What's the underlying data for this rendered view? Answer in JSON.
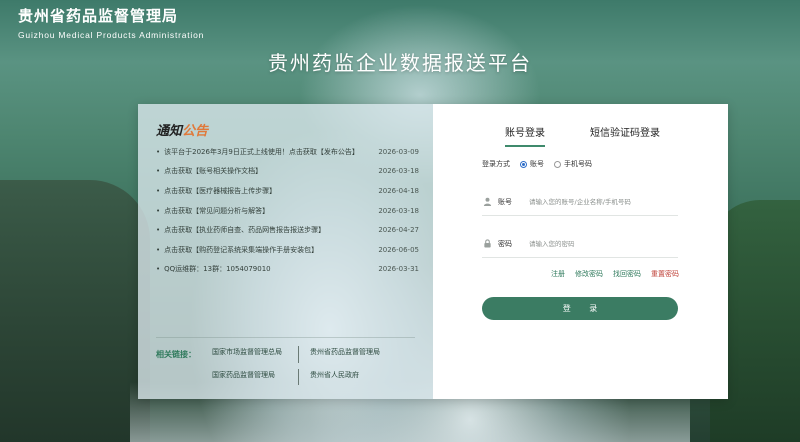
{
  "brand": {
    "name_cn": "贵州省药品监督管理局",
    "name_en": "Guizhou Medical Products Administration"
  },
  "platform_title": "贵州药监企业数据报送平台",
  "notices": {
    "heading_main": "通知",
    "heading_accent": "公告",
    "items": [
      {
        "title": "该平台于2026年3月9日正式上线使用！点击获取【发布公告】",
        "date": "2026-03-09"
      },
      {
        "title": "点击获取【账号相关操作文档】",
        "date": "2026-03-18"
      },
      {
        "title": "点击获取【医疗器械报告上传步骤】",
        "date": "2026-04-18"
      },
      {
        "title": "点击获取【常见问题分析与解答】",
        "date": "2026-03-18"
      },
      {
        "title": "点击获取【执业药师自查、药品网售报告报送步骤】",
        "date": "2026-04-27"
      },
      {
        "title": "点击获取【购药登记系统采集端操作手册安装包】",
        "date": "2026-06-05"
      },
      {
        "title": "QQ运维群：13群：1054079010",
        "date": "2026-03-31"
      }
    ]
  },
  "related_links": {
    "label": "相关链接：",
    "items": [
      "国家市场监督管理总局",
      "贵州省药品监督管理局",
      "国家药品监督管理局",
      "贵州省人民政府"
    ]
  },
  "login": {
    "tabs": [
      "账号登录",
      "短信验证码登录"
    ],
    "method_label": "登录方式",
    "method_options": [
      "账号",
      "手机号码"
    ],
    "method_selected": "账号",
    "account_label": "账号",
    "account_placeholder": "请输入您的账号/企业名称/手机号码",
    "password_label": "密码",
    "password_placeholder": "请输入您的密码",
    "aux_links": [
      "注册",
      "修改密码",
      "找回密码",
      "重置密码"
    ],
    "submit_label": "登 录"
  },
  "colors": {
    "accent_green": "#3b7c63",
    "notice_accent": "#e0793a",
    "reset_red": "#c0433a"
  },
  "icons": [
    "user-icon",
    "lock-icon"
  ]
}
